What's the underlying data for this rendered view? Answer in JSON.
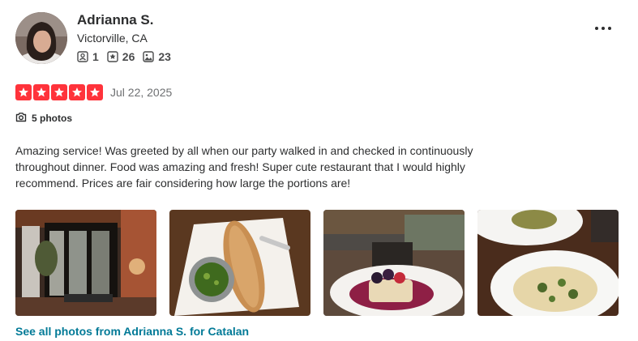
{
  "review": {
    "user": {
      "name": "Adrianna S.",
      "location": "Victorville, CA",
      "stats": [
        {
          "icon": "friends-icon",
          "value": "1"
        },
        {
          "icon": "reviews-star-icon",
          "value": "26"
        },
        {
          "icon": "photos-icon",
          "value": "23"
        }
      ]
    },
    "rating": 5,
    "date": "Jul 22, 2025",
    "photo_count_label": "5 photos",
    "text": "Amazing service! Was greeted by all when our party walked in and checked in continuously throughout dinner. Food was amazing and fresh! Super cute restaurant that I would highly recommend. Prices are fair considering how large the portions are!",
    "photos": [
      {
        "subject": "restaurant-interior"
      },
      {
        "subject": "bread-with-pesto"
      },
      {
        "subject": "dessert-with-berries"
      },
      {
        "subject": "pasta-dish"
      }
    ],
    "see_all_link": "See all photos from Adrianna S. for Catalan"
  },
  "colors": {
    "star_red": "#ff333b",
    "link_teal": "#027a97",
    "text_dark": "#2d2e2f",
    "text_muted": "#6e7072"
  }
}
